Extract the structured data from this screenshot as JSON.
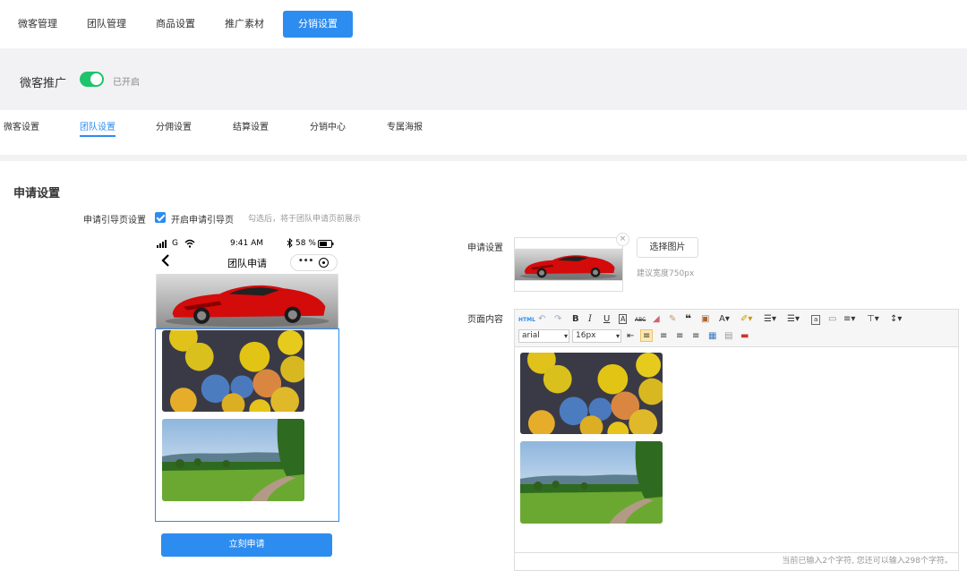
{
  "topnav": {
    "tabs": [
      {
        "label": "微客管理"
      },
      {
        "label": "团队管理"
      },
      {
        "label": "商品设置"
      },
      {
        "label": "推广素材"
      },
      {
        "label": "分销设置"
      }
    ],
    "active_index": 4
  },
  "promo": {
    "title": "微客推广",
    "toggle_state": "已开启",
    "toggle_on": true
  },
  "subnav": {
    "tabs": [
      {
        "label": "微客设置"
      },
      {
        "label": "团队设置"
      },
      {
        "label": "分佣设置"
      },
      {
        "label": "结算设置"
      },
      {
        "label": "分销中心"
      },
      {
        "label": "专属海报"
      }
    ],
    "active_index": 1
  },
  "section": {
    "title": "申请设置"
  },
  "guide": {
    "label": "申请引导页设置",
    "checkbox_label": "开启申请引导页",
    "checked": true,
    "hint": "勾选后，将于团队申请页前展示"
  },
  "phone": {
    "signal": "G",
    "time": "9:41 AM",
    "battery": "58 %",
    "page_title": "团队申请",
    "apply_button": "立刻申请"
  },
  "apply_setting": {
    "label": "申请设置",
    "select_button": "选择图片",
    "hint": "建议宽度750px"
  },
  "page_content": {
    "label": "页面内容",
    "font_family": "arial",
    "font_size": "16px",
    "footer": "当前已输入2个字符, 您还可以输入298个字符。"
  },
  "colors": {
    "accent": "#2d8cf0",
    "toggle": "#1ec36b"
  }
}
